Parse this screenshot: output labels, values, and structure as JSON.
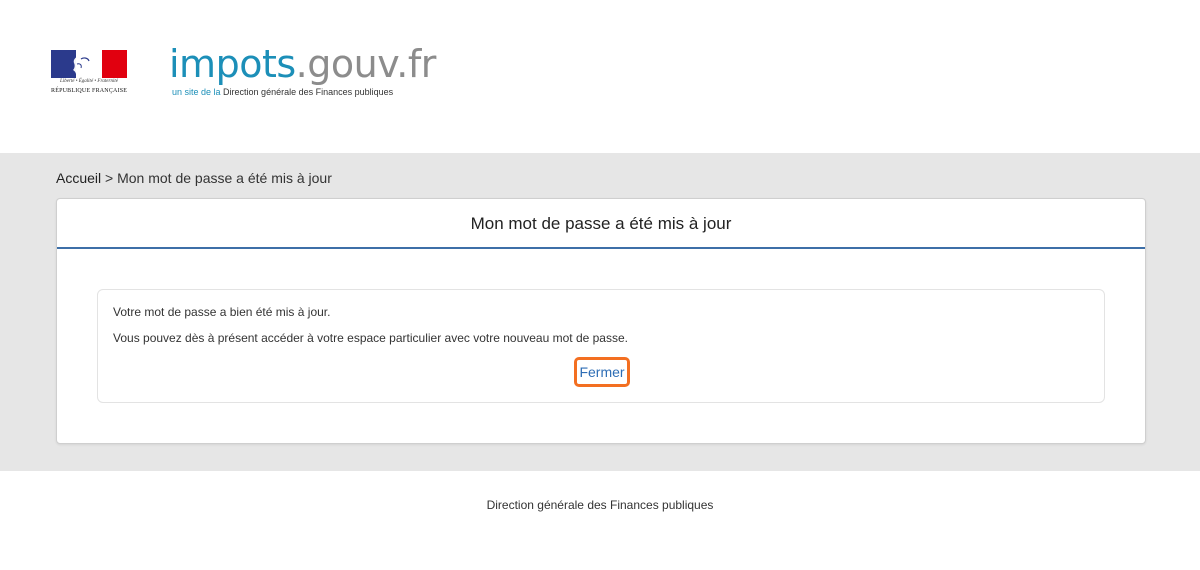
{
  "header": {
    "logo_marianne": {
      "motto": "Liberté • Égalité • Fraternité",
      "republique": "RÉPUBLIQUE FRANÇAISE",
      "colors": {
        "blue": "#2b3a8c",
        "white": "#ffffff",
        "red": "#e1000f"
      }
    },
    "brand": {
      "name_part1": "impots",
      "name_part2": ".gouv",
      "name_part3": ".fr",
      "subtitle_light": "un site de la",
      "subtitle_main": " Direction générale des Finances publiques",
      "colors": {
        "primary": "#1c8fb8",
        "secondary": "#8c8c8c"
      }
    }
  },
  "breadcrumb": {
    "home": "Accueil",
    "separator": " > ",
    "current": "Mon mot de passe a été mis à jour"
  },
  "panel": {
    "title": "Mon mot de passe a été mis à jour",
    "accent_color": "#3d6fa8",
    "message": {
      "line1": "Votre mot de passe a bien été mis à jour.",
      "line2": "Vous pouvez dès à présent accéder à votre espace particulier avec votre nouveau mot de passe."
    },
    "close_button": {
      "label": "Fermer",
      "highlight_color": "#f36f21",
      "text_color": "#2d6db5"
    }
  },
  "footer": {
    "text": "Direction générale des Finances publiques"
  }
}
